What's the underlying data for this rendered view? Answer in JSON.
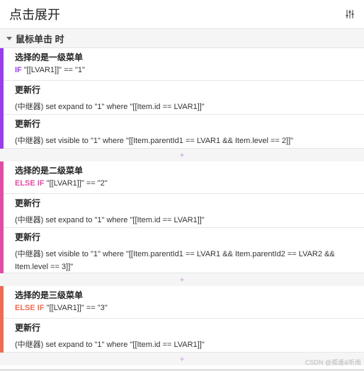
{
  "header": {
    "title": "点击展开",
    "settings_icon": "sliders-icon"
  },
  "event": {
    "label": "鼠标单击 时"
  },
  "add_symbol": "+",
  "cases": [
    {
      "heading": "选择的是一级菜单",
      "keyword": "IF",
      "condition": "\"[[LVAR1]]\" == \"1\"",
      "color": "#9b3cf0",
      "actions": [
        {
          "title": "更新行",
          "detail": "(中继器) set expand to \"1\" where \"[[Item.id == LVAR1]]\""
        },
        {
          "title": "更新行",
          "detail": "(中继器) set visible to \"1\" where \"[[Item.parentId1 == LVAR1 && Item.level == 2]]\""
        }
      ]
    },
    {
      "heading": "选择的是二级菜单",
      "keyword": "ELSE IF",
      "condition": "\"[[LVAR1]]\" == \"2\"",
      "color": "#e64aa6",
      "actions": [
        {
          "title": "更新行",
          "detail": "(中继器) set expand to \"1\" where \"[[Item.id == LVAR1]]\""
        },
        {
          "title": "更新行",
          "detail": "(中继器) set visible to \"1\" where \"[[Item.parentId1 == LVAR1 && Item.parentId2 == LVAR2 && Item.level == 3]]\""
        }
      ]
    },
    {
      "heading": "选择的是三级菜单",
      "keyword": "ELSE IF",
      "condition": "\"[[LVAR1]]\" == \"3\"",
      "color": "#f26b4f",
      "actions": [
        {
          "title": "更新行",
          "detail": "(中继器) set expand to \"1\" where \"[[Item.id == LVAR1]]\""
        }
      ]
    }
  ],
  "watermark": "CSDN @孤遥&听雨"
}
